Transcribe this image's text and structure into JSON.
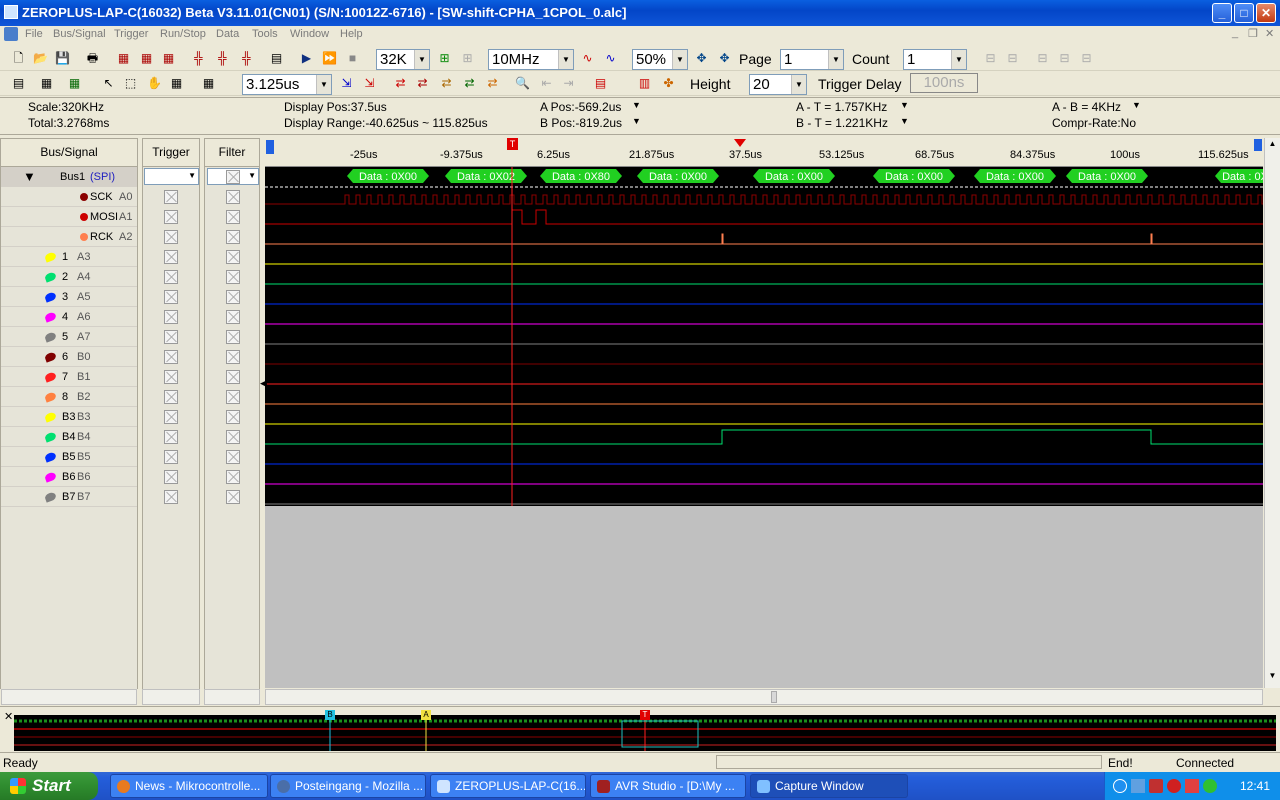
{
  "window": {
    "title": "ZEROPLUS-LAP-C(16032) Beta V3.11.01(CN01) (S/N:10012Z-6716) - [SW-shift-CPHA_1CPOL_0.alc]"
  },
  "menu": [
    "File",
    "Bus/Signal",
    "Trigger",
    "Run/Stop",
    "Data",
    "Tools",
    "Window",
    "Help"
  ],
  "toolbar1": {
    "memory_depth": "32K",
    "sample_rate": "10MHz",
    "zoom": "50%",
    "page_label": "Page",
    "page_value": "1",
    "count_label": "Count",
    "count_value": "1"
  },
  "toolbar2": {
    "time_div": "3.125us",
    "height_label": "Height",
    "height_value": "20",
    "trigger_delay_label": "Trigger Delay",
    "trigger_delay_value": "100ns"
  },
  "info": {
    "scale": "Scale:320KHz",
    "total": "Total:3.2768ms",
    "display_pos": "Display Pos:37.5us",
    "display_range": "Display Range:-40.625us ~ 115.825us",
    "a_pos": "A Pos:-569.2us",
    "b_pos": "B Pos:-819.2us",
    "a_t": "A - T = 1.757KHz",
    "b_t": "B - T = 1.221KHz",
    "a_b": "A - B = 4KHz",
    "compr": "Compr-Rate:No"
  },
  "columns": {
    "bus_signal": "Bus/Signal",
    "trigger": "Trigger",
    "filter": "Filter"
  },
  "bus": {
    "name": "Bus1",
    "type": "(SPI)"
  },
  "signals": [
    {
      "name": "SCK",
      "pin": "A0",
      "color": "#8b0000"
    },
    {
      "name": "MOSI",
      "pin": "A1",
      "color": "#cc0000"
    },
    {
      "name": "RCK",
      "pin": "A2",
      "color": "#ff7f50"
    },
    {
      "name": "1",
      "pin": "A3",
      "color": "#ffff00"
    },
    {
      "name": "2",
      "pin": "A4",
      "color": "#00e070"
    },
    {
      "name": "3",
      "pin": "A5",
      "color": "#0030ff"
    },
    {
      "name": "4",
      "pin": "A6",
      "color": "#ff00ff"
    },
    {
      "name": "5",
      "pin": "A7",
      "color": "#808080"
    },
    {
      "name": "6",
      "pin": "B0",
      "color": "#800000"
    },
    {
      "name": "7",
      "pin": "B1",
      "color": "#ff2020"
    },
    {
      "name": "8",
      "pin": "B2",
      "color": "#ff8040"
    },
    {
      "name": "B3",
      "pin": "B3",
      "color": "#ffff00"
    },
    {
      "name": "B4",
      "pin": "B4",
      "color": "#00e070"
    },
    {
      "name": "B5",
      "pin": "B5",
      "color": "#0030ff"
    },
    {
      "name": "B6",
      "pin": "B6",
      "color": "#ff00ff"
    },
    {
      "name": "B7",
      "pin": "B7",
      "color": "#808080"
    }
  ],
  "ruler_ticks": [
    "-25us",
    "-9.375us",
    "6.25us",
    "21.875us",
    "37.5us",
    "53.125us",
    "68.75us",
    "84.375us",
    "100us",
    "115.625us"
  ],
  "decode_labels": [
    "Data : 0X00",
    "Data : 0X02",
    "Data : 0X80",
    "Data : 0X00",
    "Data : 0X00",
    "Data : 0X00",
    "Data : 0X00",
    "Data : 0X00",
    "Data : 0X"
  ],
  "markers": {
    "t": "T",
    "a": "A",
    "b": "B"
  },
  "status": {
    "left": "Ready",
    "end": "End!",
    "conn": "Connected"
  },
  "taskbar": {
    "start": "Start",
    "tasks": [
      "News - Mikrocontrolle...",
      "Posteingang - Mozilla ...",
      "ZEROPLUS-LAP-C(16...",
      "AVR Studio - [D:\\My ...",
      "Capture Window"
    ],
    "clock": "12:41"
  }
}
